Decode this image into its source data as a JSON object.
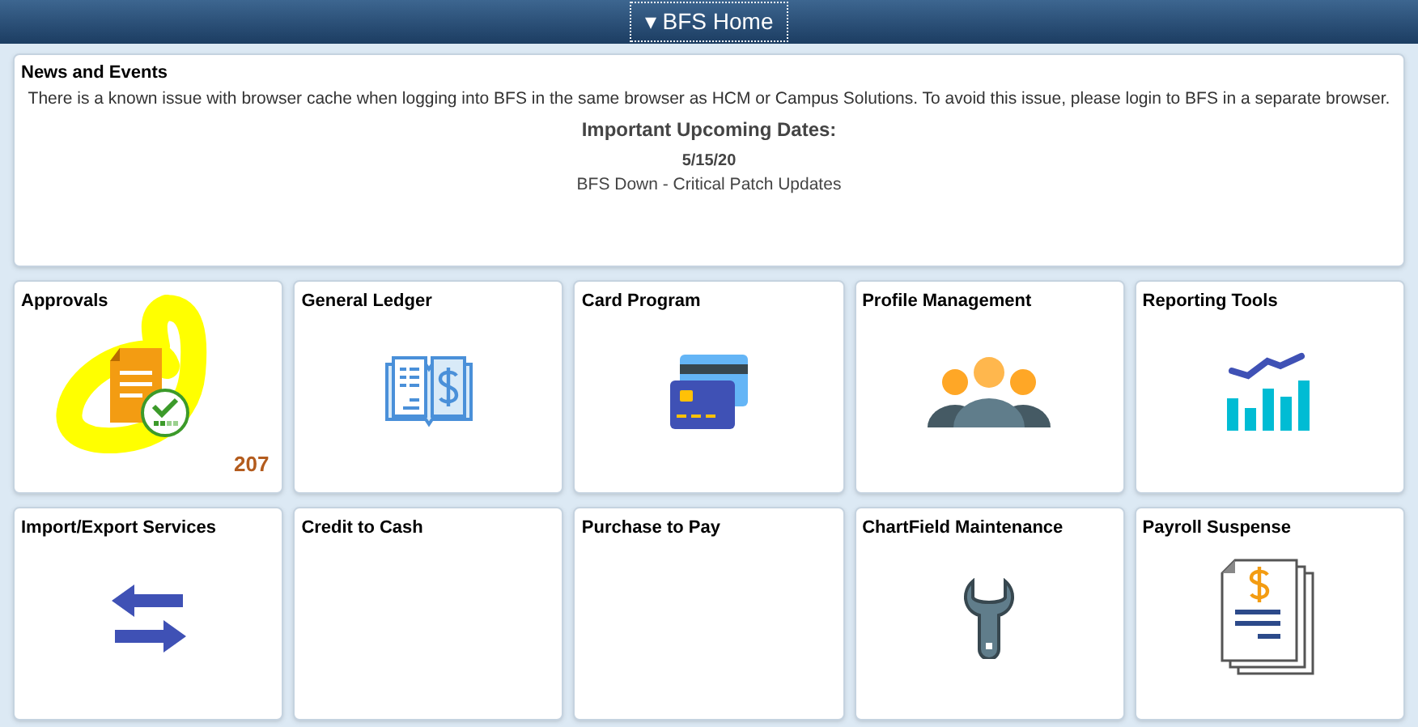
{
  "header": {
    "title": "BFS Home",
    "caret": "▾"
  },
  "news": {
    "title": "News and Events",
    "message": "There is a known issue with browser cache when logging into BFS in the same browser as HCM or Campus Solutions. To avoid this issue, please login to BFS in a separate browser.",
    "subtitle": "Important Upcoming Dates:",
    "date": "5/15/20",
    "event": "BFS Down - Critical Patch Updates"
  },
  "tiles": [
    {
      "title": "Approvals",
      "kind": "approvals",
      "count": "207",
      "highlighted": true
    },
    {
      "title": "General Ledger",
      "kind": "ledger",
      "highlighted": false
    },
    {
      "title": "Card Program",
      "kind": "card",
      "highlighted": false
    },
    {
      "title": "Profile Management",
      "kind": "people",
      "highlighted": false
    },
    {
      "title": "Reporting Tools",
      "kind": "chart",
      "highlighted": false
    },
    {
      "title": "Import/Export Services",
      "kind": "arrows",
      "highlighted": false
    },
    {
      "title": "Credit to Cash",
      "kind": "blank",
      "highlighted": false
    },
    {
      "title": "Purchase to Pay",
      "kind": "blank",
      "highlighted": false
    },
    {
      "title": "ChartField Maintenance",
      "kind": "wrench",
      "highlighted": false
    },
    {
      "title": "Payroll Suspense",
      "kind": "payroll",
      "highlighted": false
    }
  ]
}
